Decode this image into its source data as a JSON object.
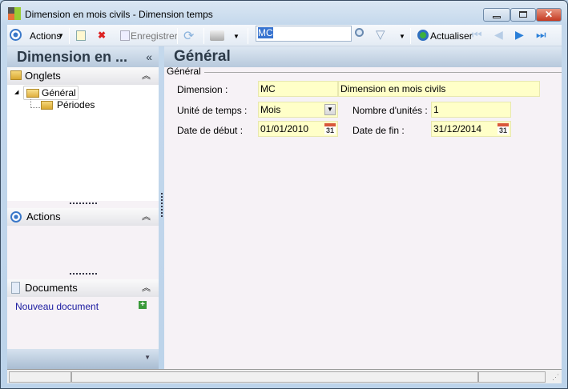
{
  "window": {
    "title": "Dimension en mois civils -  Dimension temps"
  },
  "toolbar": {
    "actions": "Actions",
    "save": "Enregistrer",
    "search_value": "MC",
    "refresh": "Actualiser"
  },
  "left": {
    "title": "Dimension en ...",
    "collapse": "«",
    "onglets": {
      "label": "Onglets",
      "items": [
        "Général",
        "Périodes"
      ]
    },
    "actions": {
      "label": "Actions"
    },
    "documents": {
      "label": "Documents",
      "new_doc": "Nouveau document"
    }
  },
  "main": {
    "title": "Général",
    "group": "Général",
    "fields": {
      "dimension_label": "Dimension :",
      "dimension_code": "MC",
      "dimension_name": "Dimension en mois civils",
      "unit_label": "Unité de temps :",
      "unit_value": "Mois",
      "count_label": "Nombre d'unités :",
      "count_value": "1",
      "start_label": "Date de début :",
      "start_value": "01/01/2010",
      "end_label": "Date de fin :",
      "end_value": "31/12/2014",
      "cal_day": "31"
    }
  }
}
